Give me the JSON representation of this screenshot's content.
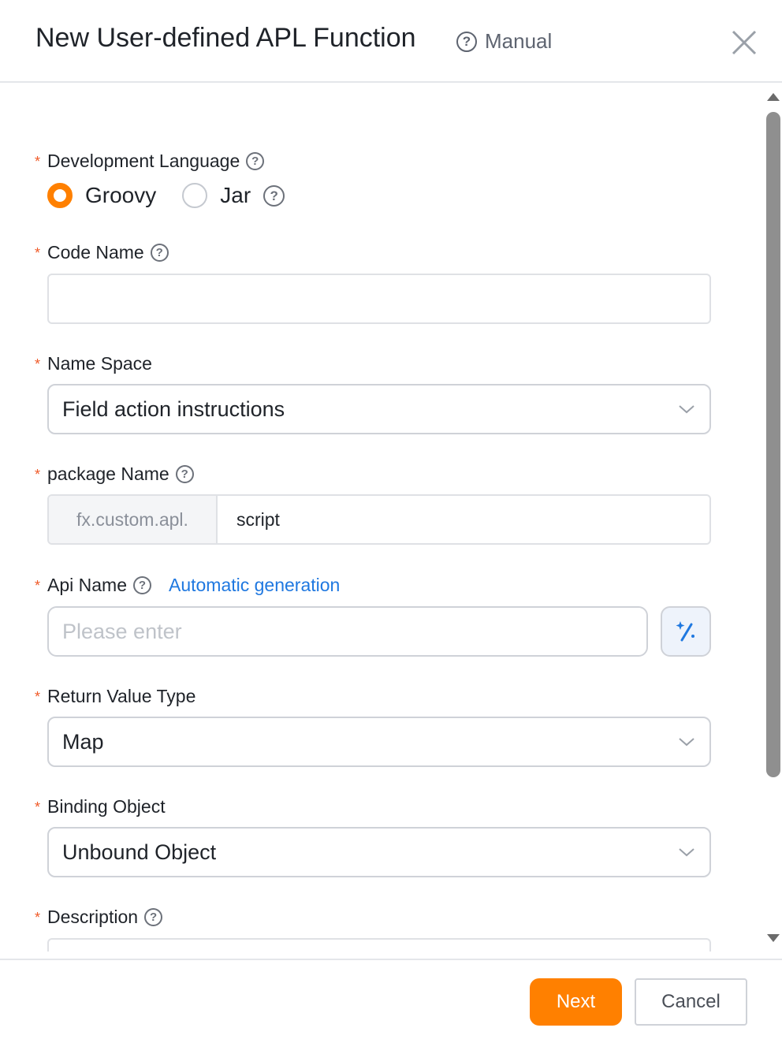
{
  "header": {
    "title": "New User-defined APL Function",
    "manual_label": "Manual"
  },
  "form": {
    "language": {
      "label": "Development Language",
      "options": [
        "Groovy",
        "Jar"
      ],
      "selected": "Groovy"
    },
    "code_name": {
      "label": "Code Name",
      "value": ""
    },
    "name_space": {
      "label": "Name Space",
      "value": "Field action instructions"
    },
    "package_name": {
      "label": "package Name",
      "prefix": "fx.custom.apl.",
      "value": "script"
    },
    "api_name": {
      "label": "Api Name",
      "link": "Automatic generation",
      "placeholder": "Please enter"
    },
    "return_type": {
      "label": "Return Value Type",
      "value": "Map"
    },
    "binding_object": {
      "label": "Binding Object",
      "value": "Unbound Object"
    },
    "description": {
      "label": "Description"
    },
    "required_mark": "*"
  },
  "footer": {
    "next_label": "Next",
    "cancel_label": "Cancel"
  },
  "colors": {
    "accent": "#ff8000",
    "link": "#1f78e0",
    "required": "#f05a28"
  }
}
